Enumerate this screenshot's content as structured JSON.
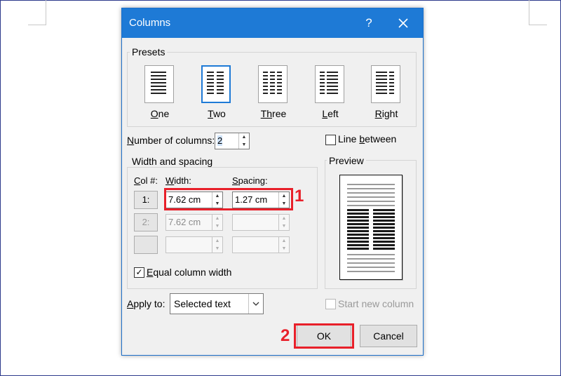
{
  "dialog": {
    "title": "Columns",
    "help_label": "?",
    "close_label": "X"
  },
  "presets": {
    "group_label": "Presets",
    "items": [
      {
        "label": "One",
        "mnemonic": "O",
        "rest": "ne",
        "selected": false
      },
      {
        "label": "Two",
        "mnemonic": "T",
        "rest": "wo",
        "selected": true
      },
      {
        "label": "Three",
        "mnemonic": "Th",
        "rest": "ree",
        "selected": false
      },
      {
        "label": "Left",
        "mnemonic": "L",
        "rest": "eft",
        "selected": false
      },
      {
        "label": "Right",
        "mnemonic": "R",
        "rest": "ight",
        "selected": false
      }
    ]
  },
  "number_of_columns": {
    "label_mnemonic": "N",
    "label_rest": "umber of columns:",
    "value": "2"
  },
  "line_between": {
    "label_pre": "Line ",
    "label_mnemonic": "b",
    "label_rest": "etween",
    "checked": false
  },
  "width_spacing": {
    "group_label": "Width and spacing",
    "col_header_mnemonic": "C",
    "col_header_rest": "ol #:",
    "width_header_mnemonic": "W",
    "width_header_rest": "idth:",
    "spacing_header_mnemonic": "S",
    "spacing_header_rest": "pacing:",
    "rows": [
      {
        "col": "1:",
        "width": "7.62 cm",
        "spacing": "1.27 cm",
        "enabled": true
      },
      {
        "col": "2:",
        "width": "7.62 cm",
        "spacing": "",
        "enabled": false
      },
      {
        "col": "",
        "width": "",
        "spacing": "",
        "enabled": false
      }
    ],
    "equal_width": {
      "label_mnemonic": "E",
      "label_rest": "qual column width",
      "checked": true,
      "check_glyph": "✓"
    }
  },
  "preview": {
    "group_label": "Preview"
  },
  "apply_to": {
    "label_mnemonic": "A",
    "label_rest": "pply to:",
    "value": "Selected text"
  },
  "start_new_column": {
    "label": "Start new column",
    "checked": false,
    "enabled": false
  },
  "buttons": {
    "ok": "OK",
    "cancel": "Cancel"
  },
  "annotations": {
    "marker_1": "1",
    "marker_2": "2",
    "color": "#e8202a"
  },
  "colors": {
    "titlebar": "#1e7ad6",
    "dialog_bg": "#f0f0f0",
    "page_border": "#2d3a8c"
  }
}
